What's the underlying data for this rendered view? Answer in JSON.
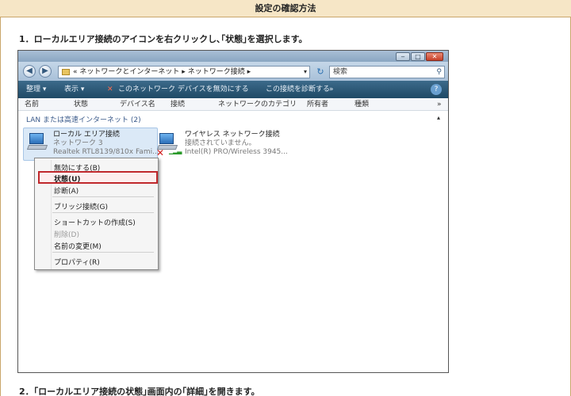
{
  "header": {
    "title": "設定の確認方法"
  },
  "steps": {
    "step1": "1．ローカルエリア接続のアイコンを右クリックし､｢状態｣を選択します。",
    "step2": "2．｢ローカルエリア接続の状態｣画面内の｢詳細｣を開きます。"
  },
  "window": {
    "buttons": {
      "min": "‒",
      "max": "□",
      "close": "✕"
    },
    "nav": {
      "back": "◀",
      "forward": "▶"
    },
    "address": {
      "prefix": "«",
      "crumb1": "ネットワークとインターネット",
      "sep": "▸",
      "crumb2": "ネットワーク接続",
      "dropdown": "▾"
    },
    "refresh": "↻",
    "search": {
      "placeholder": "検索",
      "icon": "⚲"
    },
    "toolbar": {
      "organize": "整理 ▾",
      "views": "表示 ▾",
      "disable": "このネットワーク デバイスを無効にする",
      "diagnose": "この接続を診断する",
      "more": "»",
      "help": "?"
    },
    "columns": [
      "名前",
      "状態",
      "デバイス名",
      "接続",
      "ネットワークのカテゴリ",
      "所有者",
      "種類"
    ],
    "columns_more": "»",
    "group": {
      "label": "LAN または高速インターネット (2)",
      "arrow": "▴"
    },
    "items": [
      {
        "name": "ローカル エリア接続",
        "status": "ネットワーク 3",
        "device": "Realtek RTL8139/810x Fami..."
      },
      {
        "name": "ワイヤレス ネットワーク接続",
        "status": "接続されていません。",
        "device": "Intel(R) PRO/Wireless 3945..."
      }
    ],
    "context_menu": [
      {
        "label": "無効にする(B)",
        "disabled": false
      },
      {
        "label": "状態(U)",
        "disabled": false,
        "highlighted": true
      },
      {
        "label": "診断(A)",
        "disabled": false
      },
      {
        "label": "ブリッジ接続(G)",
        "disabled": false
      },
      {
        "label": "ショートカットの作成(S)",
        "disabled": false
      },
      {
        "label": "削除(D)",
        "disabled": true
      },
      {
        "label": "名前の変更(M)",
        "disabled": false
      },
      {
        "label": "プロパティ(R)",
        "disabled": false
      }
    ],
    "icons": {
      "error": "✕",
      "signal": "▁▂▃"
    }
  },
  "colors": {
    "header_bg": "#f6e6c6",
    "accent_border": "#c9a66b",
    "highlight": "#c0282c",
    "toolbar": "#1f4a66"
  }
}
